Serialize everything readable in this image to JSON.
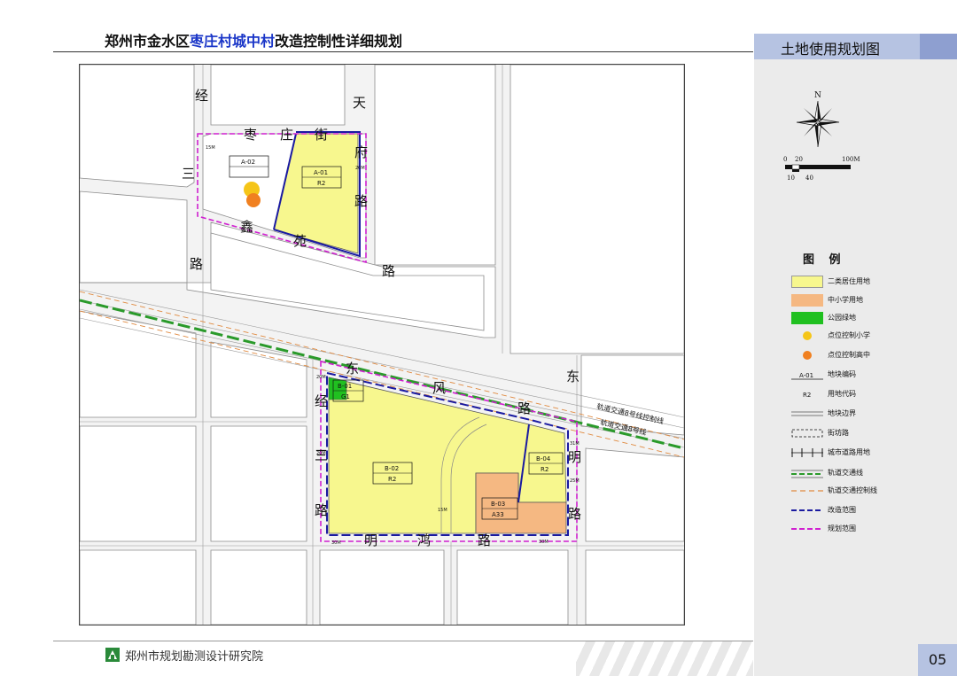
{
  "header": {
    "title_part1": "郑州市金水区",
    "title_highlight": "枣庄村城中村",
    "title_part2": "改造控制性详细规划"
  },
  "panel": {
    "title": "土地使用规划图"
  },
  "compass": {
    "north_label": "N"
  },
  "scale": {
    "top_labels": [
      "0",
      "20",
      "100M"
    ],
    "bottom_labels": [
      "10",
      "40"
    ]
  },
  "legend": {
    "title": "图 例",
    "items": [
      {
        "label": "二类居住用地",
        "color": "#f7f78e"
      },
      {
        "label": "中小学用地",
        "color": "#f5b882"
      },
      {
        "label": "公园绿地",
        "color": "#20c020"
      },
      {
        "label": "点位控制小学",
        "color": "#f5c518",
        "icon": "yellow-dot-icon"
      },
      {
        "label": "点位控制高中",
        "color": "#f08020",
        "icon": "orange-dot-icon"
      },
      {
        "label": "地块编码",
        "code": "A-01"
      },
      {
        "label": "用地代码",
        "code": "R2"
      },
      {
        "label": "地块边界"
      },
      {
        "label": "街坊路"
      },
      {
        "label": "城市道路用地"
      },
      {
        "label": "轨道交通线",
        "color": "#2a9a2a"
      },
      {
        "label": "轨道交通控制线",
        "color": "#e08a40"
      },
      {
        "label": "改造范围",
        "color": "#1a1aa0"
      },
      {
        "label": "规划范围",
        "color": "#d020d0"
      }
    ]
  },
  "map": {
    "roads": {
      "jing3_top": [
        "经",
        "三",
        "路"
      ],
      "tianfu": [
        "天",
        "府",
        "路"
      ],
      "zaozhuang": [
        "枣",
        "庄",
        "街"
      ],
      "xinyuan": [
        "鑫",
        "苑",
        "路"
      ],
      "dongfeng": [
        "东",
        "风",
        "路"
      ],
      "jing3_bottom": [
        "经",
        "三",
        "路"
      ],
      "dongming": [
        "东",
        "明",
        "路"
      ],
      "minghong": [
        "明",
        "鸿",
        "路"
      ]
    },
    "rail_labels": [
      "轨道交通8号线控制线",
      "轨道交通8号线"
    ],
    "widths": {
      "w15": "15M",
      "w20": "20M",
      "w25": "25M",
      "w30": "30M",
      "w31": "31M"
    },
    "parcels": {
      "a01": {
        "code": "A-01",
        "use": "R2"
      },
      "a02": {
        "code": "A-02",
        "use": ""
      },
      "b01": {
        "code": "B-01",
        "use": "G1"
      },
      "b02": {
        "code": "B-02",
        "use": "R2"
      },
      "b03": {
        "code": "B-03",
        "use": "A33"
      },
      "b04": {
        "code": "B-04",
        "use": "R2"
      }
    }
  },
  "footer": {
    "org": "郑州市规划勘测设计研究院",
    "page": "05"
  }
}
